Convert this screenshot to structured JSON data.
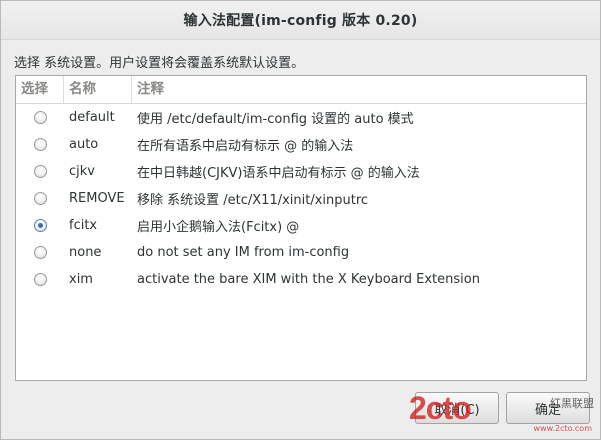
{
  "window": {
    "title": "输入法配置(im-config 版本 0.20)"
  },
  "message": "选择 系统设置。用户设置将会覆盖系统默认设置。",
  "table": {
    "headers": {
      "select": "选择",
      "name": "名称",
      "note": "注释"
    },
    "rows": [
      {
        "name": "default",
        "note": "使用 /etc/default/im-config 设置的 auto 模式",
        "selected": false
      },
      {
        "name": "auto",
        "note": "在所有语系中启动有标示 @ 的输入法",
        "selected": false
      },
      {
        "name": "cjkv",
        "note": "在中日韩越(CJKV)语系中启动有标示 @ 的输入法",
        "selected": false
      },
      {
        "name": "REMOVE",
        "note": "移除 系统设置 /etc/X11/xinit/xinputrc",
        "selected": false
      },
      {
        "name": "fcitx",
        "note": "启用小企鹅输入法(Fcitx) @",
        "selected": true
      },
      {
        "name": "none",
        "note": "do not set any IM from im-config",
        "selected": false
      },
      {
        "name": "xim",
        "note": "activate the bare XIM with the X Keyboard Extension",
        "selected": false
      }
    ]
  },
  "buttons": {
    "cancel": "取消(C)",
    "ok": "确定"
  },
  "watermark": {
    "logo": "2cto",
    "side": "红黑联盟",
    "url": "www.2cto.com"
  }
}
